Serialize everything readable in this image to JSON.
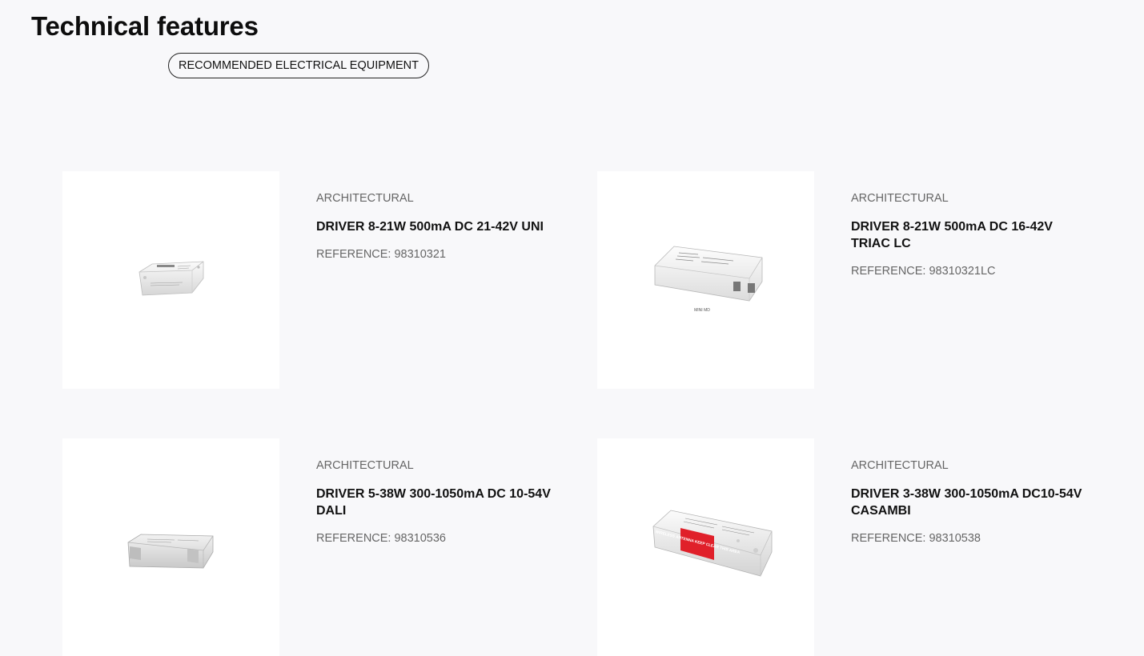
{
  "page": {
    "title": "Technical features",
    "tab_label": "RECOMMENDED ELECTRICAL EQUIPMENT"
  },
  "products": [
    {
      "category": "ARCHITECTURAL",
      "name": "DRIVER 8-21W 500mA DC 21-42V UNI",
      "reference_label": "REFERENCE:",
      "reference": "98310321"
    },
    {
      "category": "ARCHITECTURAL",
      "name": "DRIVER 8-21W 500mA DC 16-42V TRIAC LC",
      "reference_label": "REFERENCE:",
      "reference": "98310321LC",
      "image_caption": "MINI MD"
    },
    {
      "category": "ARCHITECTURAL",
      "name": "DRIVER 5-38W 300-1050mA DC 10-54V DALI",
      "reference_label": "REFERENCE:",
      "reference": "98310536"
    },
    {
      "category": "ARCHITECTURAL",
      "name": "DRIVER 3-38W 300-1050mA DC10-54V CASAMBI",
      "reference_label": "REFERENCE:",
      "reference": "98310538",
      "image_sticker": "WIRELESS ANTENNA KEEP CLEAR THIS AREA"
    }
  ],
  "colors": {
    "background": "#f8f8fa",
    "card_image_bg": "#ffffff",
    "muted_text": "#666666",
    "sticker_red": "#e0202a"
  }
}
